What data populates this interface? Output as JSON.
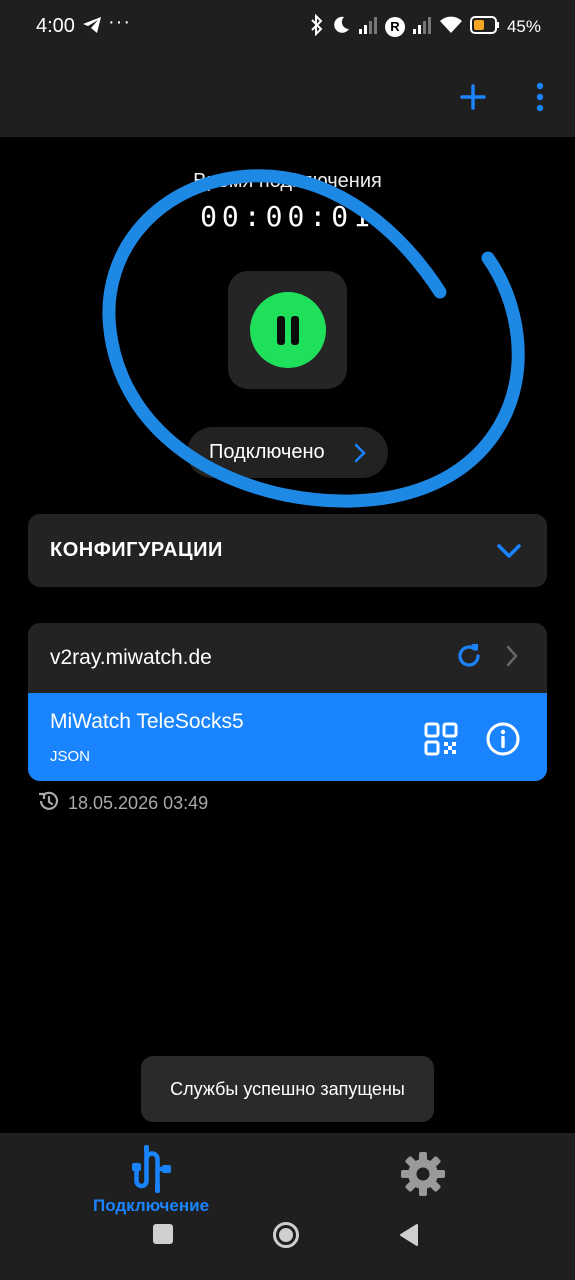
{
  "status_bar": {
    "time": "4:00",
    "dots": "···",
    "battery_percent": "45%",
    "r_badge": "R",
    "icons": [
      "telegram-icon",
      "bluetooth-icon",
      "moon-icon",
      "signal-icon",
      "wifi-icon",
      "battery-icon"
    ]
  },
  "app_bar": {
    "actions": [
      "add-icon",
      "more-vert-icon"
    ]
  },
  "connection": {
    "time_label": "Время подключения",
    "timer": "00:00:01",
    "status": "Подключено",
    "toggle_state": "connected"
  },
  "configurations": {
    "title": "КОНФИГУРАЦИИ"
  },
  "subscription": {
    "name": "v2ray.miwatch.de",
    "profile": {
      "name": "MiWatch TeleSocks5",
      "type": "JSON"
    },
    "updated": "18.05.2026 03:49"
  },
  "toast": {
    "message": "Службы успешно запущены"
  },
  "bottom_nav": {
    "connect_label": "Подключение",
    "items": [
      "connection-icon",
      "settings-icon"
    ]
  },
  "colors": {
    "accent": "#1a84ff",
    "connected_green": "#1fe05a",
    "background": "#000000",
    "surface": "#232323",
    "annotation_circle": "#1e88e5"
  }
}
